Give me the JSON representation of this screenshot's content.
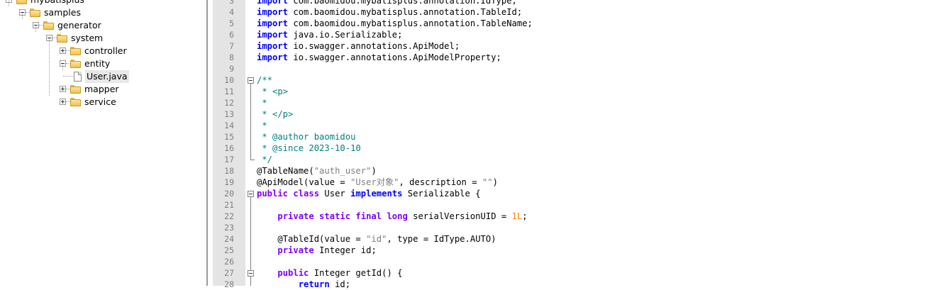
{
  "tree": {
    "items": [
      {
        "label": "mybatisplus",
        "type": "folder",
        "state": "expanded",
        "depth": 0
      },
      {
        "label": "samples",
        "type": "folder",
        "state": "expanded",
        "depth": 1
      },
      {
        "label": "generator",
        "type": "folder",
        "state": "expanded",
        "depth": 2
      },
      {
        "label": "system",
        "type": "folder",
        "state": "expanded",
        "depth": 3
      },
      {
        "label": "controller",
        "type": "folder",
        "state": "collapsed",
        "depth": 4
      },
      {
        "label": "entity",
        "type": "folder",
        "state": "expanded",
        "depth": 4
      },
      {
        "label": "User.java",
        "type": "file",
        "state": "selected",
        "depth": 5
      },
      {
        "label": "mapper",
        "type": "folder",
        "state": "collapsed",
        "depth": 4
      },
      {
        "label": "service",
        "type": "folder",
        "state": "collapsed",
        "depth": 4
      }
    ]
  },
  "editor": {
    "lines": [
      {
        "n": "3",
        "tokens": [
          [
            "kw",
            "import"
          ],
          [
            "",
            "com.baomidou.mybatisplus.annotation.IdType;"
          ]
        ]
      },
      {
        "n": "4",
        "tokens": [
          [
            "kw",
            "import"
          ],
          [
            "",
            "com.baomidou.mybatisplus.annotation.TableId;"
          ]
        ]
      },
      {
        "n": "5",
        "tokens": [
          [
            "kw",
            "import"
          ],
          [
            "",
            "com.baomidou.mybatisplus.annotation.TableName;"
          ]
        ]
      },
      {
        "n": "6",
        "tokens": [
          [
            "kw",
            "import"
          ],
          [
            "",
            "java.io.Serializable;"
          ]
        ]
      },
      {
        "n": "7",
        "tokens": [
          [
            "kw",
            "import"
          ],
          [
            "",
            "io.swagger.annotations.ApiModel;"
          ]
        ]
      },
      {
        "n": "8",
        "tokens": [
          [
            "kw",
            "import"
          ],
          [
            "",
            "io.swagger.annotations.ApiModelProperty;"
          ]
        ]
      },
      {
        "n": "9",
        "tokens": []
      },
      {
        "n": "10",
        "tokens": [
          [
            "cm",
            "/**"
          ]
        ]
      },
      {
        "n": "11",
        "tokens": [
          [
            "cm",
            " * <p>"
          ]
        ]
      },
      {
        "n": "12",
        "tokens": [
          [
            "cm",
            " *"
          ]
        ]
      },
      {
        "n": "13",
        "tokens": [
          [
            "cm",
            " * </p>"
          ]
        ]
      },
      {
        "n": "14",
        "tokens": [
          [
            "cm",
            " *"
          ]
        ]
      },
      {
        "n": "15",
        "tokens": [
          [
            "cm",
            " * @author baomidou"
          ]
        ]
      },
      {
        "n": "16",
        "tokens": [
          [
            "cm",
            " * @since 2023-10-10"
          ]
        ]
      },
      {
        "n": "17",
        "tokens": [
          [
            "cm",
            " */"
          ]
        ]
      },
      {
        "n": "18",
        "tokens": [
          [
            "",
            "@TableName("
          ],
          [
            "st",
            "\"auth_user\""
          ],
          [
            "",
            ")"
          ]
        ]
      },
      {
        "n": "19",
        "tokens": [
          [
            "",
            "@ApiModel(value = "
          ],
          [
            "st",
            "\"User对象\""
          ],
          [
            "",
            ", description = "
          ],
          [
            "st",
            "\"\""
          ],
          [
            "",
            ")"
          ]
        ]
      },
      {
        "n": "20",
        "tokens": [
          [
            "kwp",
            "public class"
          ],
          [
            "",
            " User "
          ],
          [
            "kw",
            "implements"
          ],
          [
            "",
            " Serializable {"
          ]
        ]
      },
      {
        "n": "21",
        "tokens": []
      },
      {
        "n": "22",
        "tokens": [
          [
            "",
            "    "
          ],
          [
            "kwp",
            "private static final long"
          ],
          [
            "",
            " serialVersionUID = "
          ],
          [
            "num",
            "1L"
          ],
          [
            "",
            ";"
          ]
        ]
      },
      {
        "n": "23",
        "tokens": []
      },
      {
        "n": "24",
        "tokens": [
          [
            "",
            "    @TableId(value = "
          ],
          [
            "st",
            "\"id\""
          ],
          [
            "",
            ", type = IdType.AUTO)"
          ]
        ]
      },
      {
        "n": "25",
        "tokens": [
          [
            "",
            "    "
          ],
          [
            "kwp",
            "private"
          ],
          [
            "",
            " Integer id;"
          ]
        ]
      },
      {
        "n": "26",
        "tokens": []
      },
      {
        "n": "27",
        "tokens": [
          [
            "",
            "    "
          ],
          [
            "kwp",
            "public"
          ],
          [
            "",
            " Integer getId() {"
          ]
        ]
      },
      {
        "n": "28",
        "tokens": [
          [
            "",
            "        "
          ],
          [
            "kw",
            "return"
          ],
          [
            "",
            " id;"
          ]
        ]
      }
    ]
  }
}
